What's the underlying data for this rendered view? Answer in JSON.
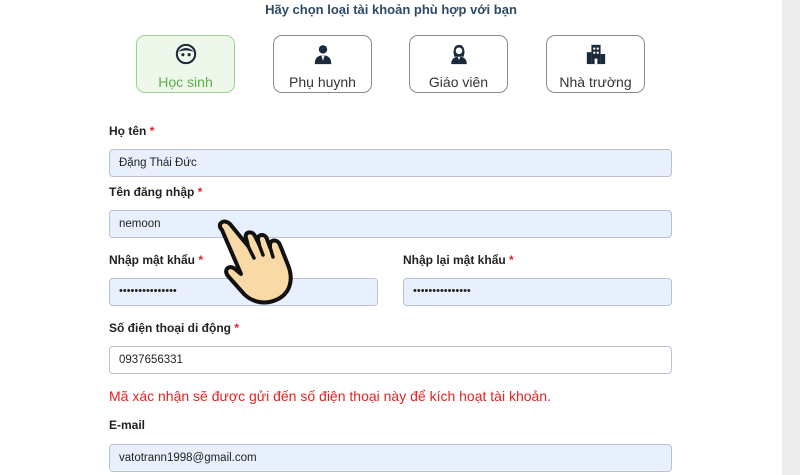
{
  "heading": "Hãy chọn loại tài khoản phù hợp với bạn",
  "account_types": [
    {
      "label": "Học sinh",
      "icon": "student-icon",
      "selected": true
    },
    {
      "label": "Phụ huynh",
      "icon": "parent-icon",
      "selected": false
    },
    {
      "label": "Giáo viên",
      "icon": "teacher-icon",
      "selected": false
    },
    {
      "label": "Nhà trường",
      "icon": "school-icon",
      "selected": false
    }
  ],
  "form": {
    "full_name": {
      "label": "Họ tên",
      "required_mark": "*",
      "value": "Đặng Thái Đức"
    },
    "username": {
      "label": "Tên đăng nhập",
      "required_mark": "*",
      "value": "nemoon"
    },
    "password": {
      "label": "Nhập mật khẩu",
      "required_mark": "*",
      "value": "•••••••••••••••"
    },
    "confirm_password": {
      "label": "Nhập lại mật khẩu",
      "required_mark": "*",
      "value": "•••••••••••••••"
    },
    "phone": {
      "label": "Số điện thoại di động",
      "required_mark": "*",
      "value": "0937656331"
    },
    "phone_notice": "Mã xác nhận sẽ được gửi đến số điện thoại này để kích hoạt tài khoản.",
    "email": {
      "label": "E-mail",
      "value": "vatotrann1998@gmail.com"
    }
  },
  "colors": {
    "selected_border": "#9ad28c",
    "selected_text": "#5bb04a",
    "required": "#e52222",
    "field_fill": "#e9f0fd"
  }
}
